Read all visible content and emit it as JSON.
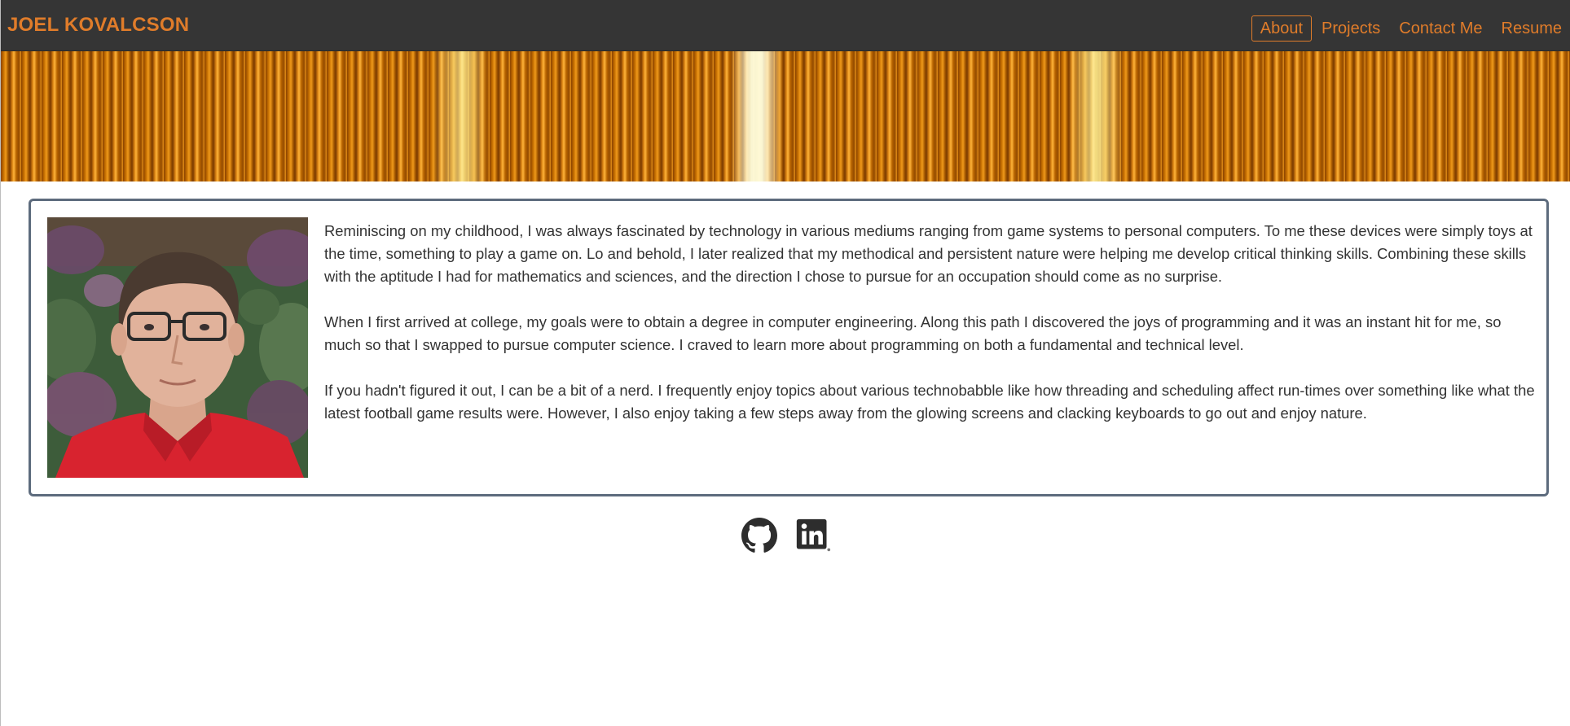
{
  "header": {
    "brand": "JOEL KOVALCSON",
    "nav": [
      {
        "label": "About",
        "active": true
      },
      {
        "label": "Projects",
        "active": false
      },
      {
        "label": "Contact Me",
        "active": false
      },
      {
        "label": "Resume",
        "active": false
      }
    ]
  },
  "about": {
    "paragraphs": [
      "Reminiscing on my childhood, I was always fascinated by technology in various mediums ranging from game systems to personal computers. To me these devices were simply toys at the time, something to play a game on. Lo and behold, I later realized that my methodical and persistent nature were helping me develop critical thinking skills. Combining these skills with the aptitude I had for mathematics and sciences, and the direction I chose to pursue for an occupation should come as no surprise.",
      "When I first arrived at college, my goals were to obtain a degree in computer engineering. Along this path I discovered the joys of programming and it was an instant hit for me, so much so that I swapped to pursue computer science. I craved to learn more about programming on both a fundamental and technical level.",
      "If you hadn't figured it out, I can be a bit of a nerd. I frequently enjoy topics about various technobabble like how threading and scheduling affect run-times over something like what the latest football game results were. However, I also enjoy taking a few steps away from the glowing screens and clacking keyboards to go out and enjoy nature."
    ]
  },
  "social": {
    "icons": [
      "github-icon",
      "linkedin-icon"
    ]
  },
  "colors": {
    "accent": "#e07c2a",
    "navbar": "#353535",
    "card_border": "#5d6b7d",
    "text": "#333333"
  }
}
